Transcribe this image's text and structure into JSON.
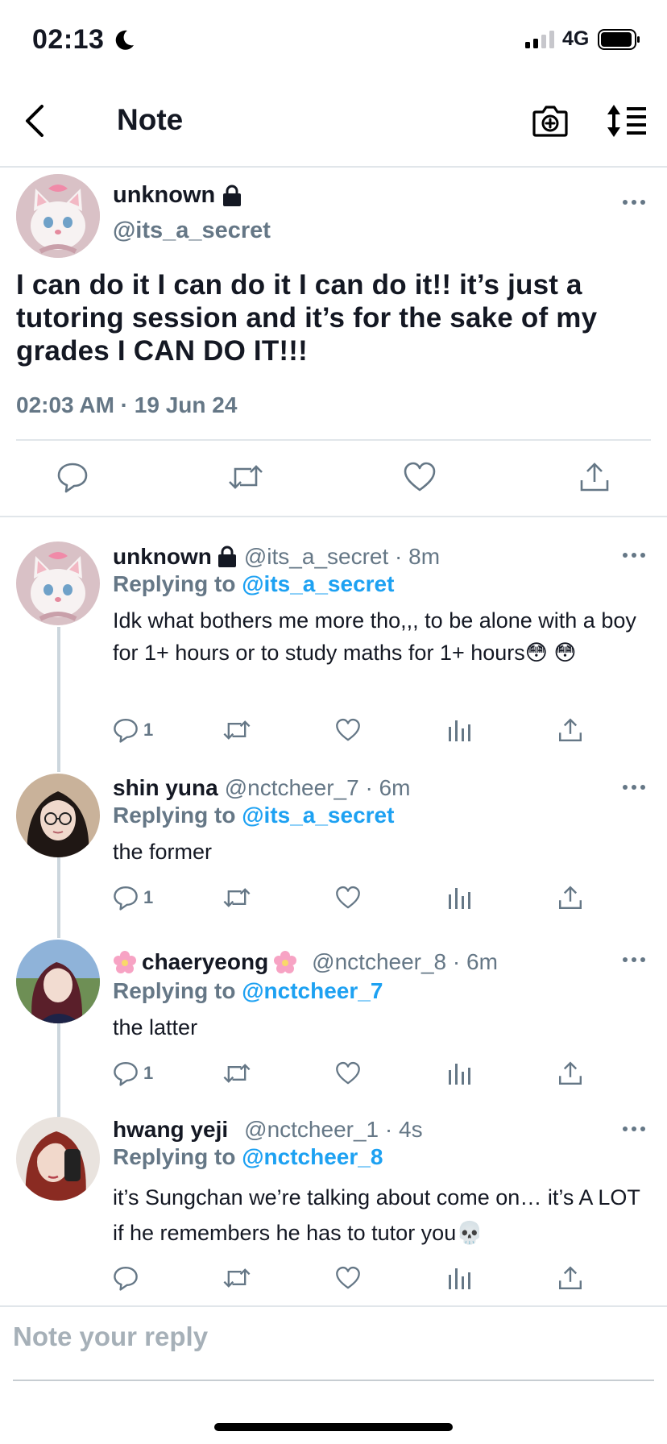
{
  "status_bar": {
    "time": "02:13",
    "network": "4G"
  },
  "nav": {
    "title": "Note"
  },
  "main_tweet": {
    "name": "unknown",
    "handle": "@its_a_secret",
    "text": "I can do it I can do it I can do it!! it’s just a tutoring session and it’s for the sake of my grades I CAN DO IT!!!",
    "timestamp": "02:03 AM · 19 Jun 24"
  },
  "replies": [
    {
      "name": "unknown",
      "handle_time": "@its_a_secret · 8m",
      "replying_label": "Replying to",
      "replying_to": "@its_a_secret",
      "text": "Idk what bothers me more tho,,, to be alone with a boy for 1+ hours or to study maths for 1+ hours😳 😳",
      "reply_count": "1"
    },
    {
      "name": "shin yuna",
      "handle_time": "@nctcheer_7 · 6m",
      "replying_label": "Replying to",
      "replying_to": "@its_a_secret",
      "text": "the former",
      "reply_count": "1"
    },
    {
      "name": "chaeryeong",
      "handle_time": "@nctcheer_8 · 6m",
      "replying_label": "Replying to",
      "replying_to": "@nctcheer_7",
      "text": "the latter",
      "reply_count": "1"
    },
    {
      "name": "hwang yeji",
      "handle_time": "@nctcheer_1 · 4s",
      "replying_label": "Replying to",
      "replying_to": "@nctcheer_8",
      "text": "it’s Sungchan we’re talking about come on… it’s A LOT if he remembers he has to tutor you💀",
      "reply_count": ""
    }
  ],
  "compose": {
    "placeholder": "Note your reply"
  },
  "colors": {
    "accent": "#1da1f2",
    "muted": "#657786",
    "text": "#141823",
    "divider": "#e1e6ea"
  },
  "icons": [
    "moon-icon",
    "signal-icon",
    "battery-icon",
    "back-icon",
    "camera-plus-icon",
    "sort-icon",
    "lock-icon",
    "more-icon",
    "reply-icon",
    "retweet-icon",
    "like-icon",
    "analytics-icon",
    "share-icon"
  ]
}
